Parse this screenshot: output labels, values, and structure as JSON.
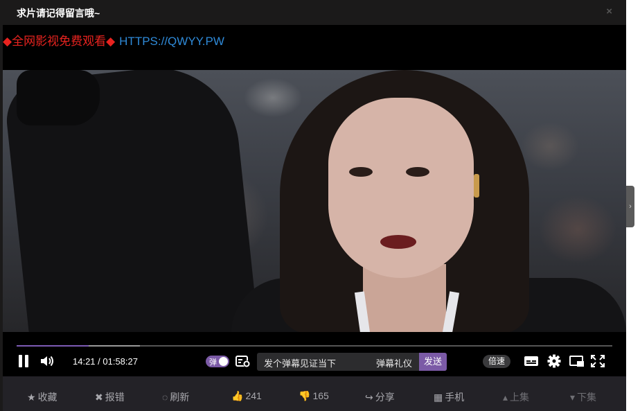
{
  "dialog": {
    "title": "求片请记得留言哦~",
    "close_label": "×"
  },
  "ad_banner": {
    "promo_text": "◆全网影视免费观看◆",
    "url_text": "HTTPS://QWYY.PW",
    "promo_color": "#e8231f",
    "url_color": "#2f8ad8"
  },
  "player": {
    "progress": {
      "played_fraction": 0.121,
      "buffered_fraction": 0.207
    },
    "current_time": "14:21",
    "duration": "01:58:27",
    "time_display": "14:21 / 01:58:27",
    "danmaku_toggle_label": "弹",
    "danmaku_placeholder": "发个弹幕见证当下",
    "danmaku_gift_label": "弹幕礼仪",
    "danmaku_send_label": "发送",
    "speed_label": "倍速",
    "accent_color": "#7b5aa6",
    "icons": [
      "pause-icon",
      "volume-icon",
      "danmaku-settings-icon",
      "subtitle-icon",
      "gear-icon",
      "picture-in-picture-icon",
      "fullscreen-icon"
    ]
  },
  "actions": {
    "favorite_label": "收藏",
    "report_label": "报错",
    "refresh_label": "刷新",
    "like_count": "241",
    "dislike_count": "165",
    "share_label": "分享",
    "mobile_label": "手机",
    "prev_label": "上集",
    "next_label": "下集"
  }
}
